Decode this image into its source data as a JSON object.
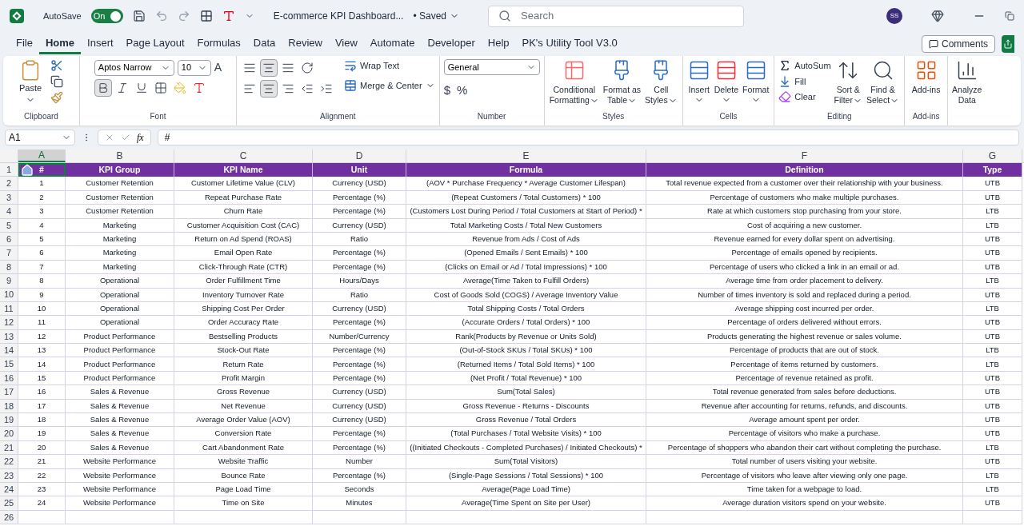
{
  "title_bar": {
    "autosave_label": "AutoSave",
    "autosave_on": true,
    "autosave_state": "On",
    "file_title": "E-commerce KPI Dashboard...",
    "save_status": "• Saved",
    "search_placeholder": "Search",
    "user_initials": "SS"
  },
  "menu_tabs": [
    {
      "label": "File",
      "selected": false
    },
    {
      "label": "Home",
      "selected": true
    },
    {
      "label": "Insert",
      "selected": false
    },
    {
      "label": "Page Layout",
      "selected": false
    },
    {
      "label": "Formulas",
      "selected": false
    },
    {
      "label": "Data",
      "selected": false
    },
    {
      "label": "Review",
      "selected": false
    },
    {
      "label": "View",
      "selected": false
    },
    {
      "label": "Automate",
      "selected": false
    },
    {
      "label": "Developer",
      "selected": false
    },
    {
      "label": "Help",
      "selected": false
    },
    {
      "label": "PK's Utility Tool V3.0",
      "selected": false
    }
  ],
  "comments_button": "Comments",
  "ribbon": {
    "clipboard": {
      "label": "Clipboard",
      "paste": "Paste"
    },
    "font": {
      "label": "Font",
      "font_name": "Aptos Narrow",
      "font_size": "10",
      "grow_font": "A",
      "bold": true,
      "italic": false,
      "underline": false
    },
    "alignment": {
      "label": "Alignment",
      "vertical_middle": true,
      "horizontal_center": true,
      "wrap_text": "Wrap Text",
      "merge": "Merge & Center"
    },
    "number": {
      "label": "Number",
      "format": "General",
      "currency": "$",
      "percent": "%"
    },
    "styles": {
      "label": "Styles",
      "buttons": [
        {
          "lines": [
            "Conditional",
            "Formatting"
          ],
          "dropdown": true
        },
        {
          "lines": [
            "Format as",
            "Table"
          ],
          "dropdown": true
        },
        {
          "lines": [
            "Cell",
            "Styles"
          ],
          "dropdown": true
        }
      ]
    },
    "cells": {
      "label": "Cells",
      "buttons": [
        {
          "lines": [
            "Insert"
          ],
          "dropdown": true
        },
        {
          "lines": [
            "Delete"
          ],
          "dropdown": true
        },
        {
          "lines": [
            "Format"
          ],
          "dropdown": true
        }
      ]
    },
    "editing": {
      "label": "Editing",
      "autosum": "AutoSum",
      "fill": "Fill",
      "clear": "Clear",
      "buttons": [
        {
          "lines": [
            "Sort &",
            "Filter"
          ],
          "dropdown": true
        },
        {
          "lines": [
            "Find &",
            "Select"
          ],
          "dropdown": true
        }
      ]
    },
    "addins": {
      "label": "Add-ins",
      "buttons": [
        {
          "lines": [
            "Add-ins"
          ],
          "dropdown": false
        }
      ]
    },
    "analyze": {
      "lines": [
        "Analyze",
        "Data"
      ]
    }
  },
  "formula_bar": {
    "name_box": "A1",
    "function_label": "fx",
    "formula": "#"
  },
  "sheet": {
    "columns": [
      {
        "label": "A",
        "selected": true
      },
      {
        "label": "B",
        "selected": false
      },
      {
        "label": "C",
        "selected": false
      },
      {
        "label": "D",
        "selected": false
      },
      {
        "label": "E",
        "selected": false
      },
      {
        "label": "F",
        "selected": false
      },
      {
        "label": "G",
        "selected": false
      }
    ],
    "row_numbers": [
      "1",
      "2",
      "3",
      "4",
      "5",
      "6",
      "7",
      "8",
      "9",
      "10",
      "11",
      "12",
      "13",
      "14",
      "15",
      "16",
      "17",
      "18",
      "19",
      "20",
      "21",
      "22",
      "23",
      "24",
      "25",
      "26"
    ],
    "header": [
      "#",
      "KPI Group",
      "KPI Name",
      "Unit",
      "Formula",
      "Definition",
      "Type"
    ],
    "rows": [
      [
        "1",
        "Customer Retention",
        "Customer Lifetime Value (CLV)",
        "Currency (USD)",
        "(AOV * Purchase Frequency * Average Customer Lifespan)",
        "Total revenue expected from a customer over their relationship with your business.",
        "UTB"
      ],
      [
        "2",
        "Customer Retention",
        "Repeat Purchase Rate",
        "Percentage (%)",
        "(Repeat Customers / Total Customers) * 100",
        "Percentage of customers who make multiple purchases.",
        "UTB"
      ],
      [
        "3",
        "Customer Retention",
        "Churn Rate",
        "Percentage (%)",
        "(Customers Lost During Period / Total Customers at Start of Period) *",
        "Rate at which customers stop purchasing from your store.",
        "LTB"
      ],
      [
        "4",
        "Marketing",
        "Customer Acquisition Cost (CAC)",
        "Currency (USD)",
        "Total Marketing Costs / Total New Customers",
        "Cost of acquiring a new customer.",
        "LTB"
      ],
      [
        "5",
        "Marketing",
        "Return on Ad Spend (ROAS)",
        "Ratio",
        "Revenue from Ads / Cost of Ads",
        "Revenue earned for every dollar spent on advertising.",
        "UTB"
      ],
      [
        "6",
        "Marketing",
        "Email Open Rate",
        "Percentage (%)",
        "(Opened Emails / Sent Emails) * 100",
        "Percentage of emails opened by recipients.",
        "UTB"
      ],
      [
        "7",
        "Marketing",
        "Click-Through Rate (CTR)",
        "Percentage (%)",
        "(Clicks on Email or Ad / Total Impressions) * 100",
        "Percentage of users who clicked a link in an email or ad.",
        "UTB"
      ],
      [
        "8",
        "Operational",
        "Order Fulfillment Time",
        "Hours/Days",
        "Average(Time Taken to Fulfill Orders)",
        "Average time from order placement to delivery.",
        "LTB"
      ],
      [
        "9",
        "Operational",
        "Inventory Turnover Rate",
        "Ratio",
        "Cost of Goods Sold (COGS) / Average Inventory Value",
        "Number of times inventory is sold and replaced during a period.",
        "UTB"
      ],
      [
        "10",
        "Operational",
        "Shipping Cost Per Order",
        "Currency (USD)",
        "Total Shipping Costs / Total Orders",
        "Average shipping cost incurred per order.",
        "LTB"
      ],
      [
        "11",
        "Operational",
        "Order Accuracy Rate",
        "Percentage (%)",
        "(Accurate Orders / Total Orders) * 100",
        "Percentage of orders delivered without errors.",
        "UTB"
      ],
      [
        "12",
        "Product Performance",
        "Bestselling Products",
        "Number/Currency",
        "Rank(Products by Revenue or Units Sold)",
        "Products generating the highest revenue or sales volume.",
        "UTB"
      ],
      [
        "13",
        "Product Performance",
        "Stock-Out Rate",
        "Percentage (%)",
        "(Out-of-Stock SKUs / Total SKUs) * 100",
        "Percentage of products that are out of stock.",
        "LTB"
      ],
      [
        "14",
        "Product Performance",
        "Return Rate",
        "Percentage (%)",
        "(Returned Items / Total Sold Items) * 100",
        "Percentage of items returned by customers.",
        "LTB"
      ],
      [
        "15",
        "Product Performance",
        "Profit Margin",
        "Percentage (%)",
        "(Net Profit / Total Revenue) * 100",
        "Percentage of revenue retained as profit.",
        "UTB"
      ],
      [
        "16",
        "Sales & Revenue",
        "Gross Revenue",
        "Currency (USD)",
        "Sum(Total Sales)",
        "Total revenue generated from sales before deductions.",
        "UTB"
      ],
      [
        "17",
        "Sales & Revenue",
        "Net Revenue",
        "Currency (USD)",
        "Gross Revenue - Returns - Discounts",
        "Revenue after accounting for returns, refunds, and discounts.",
        "UTB"
      ],
      [
        "18",
        "Sales & Revenue",
        "Average Order Value (AOV)",
        "Currency (USD)",
        "Gross Revenue / Total Orders",
        "Average amount spent per order.",
        "UTB"
      ],
      [
        "19",
        "Sales & Revenue",
        "Conversion Rate",
        "Percentage (%)",
        "(Total Purchases / Total Website Visits) * 100",
        "Percentage of visitors who make a purchase.",
        "UTB"
      ],
      [
        "20",
        "Sales & Revenue",
        "Cart Abandonment Rate",
        "Percentage (%)",
        "((Initiated Checkouts - Completed Purchases) / Initiated Checkouts) *",
        "Percentage of shoppers who abandon their cart without completing the purchase.",
        "LTB"
      ],
      [
        "21",
        "Website Performance",
        "Website Traffic",
        "Number",
        "Sum(Total Visitors)",
        "Total number of users visiting your website.",
        "UTB"
      ],
      [
        "22",
        "Website Performance",
        "Bounce Rate",
        "Percentage (%)",
        "(Single-Page Sessions / Total Sessions) * 100",
        "Percentage of visitors who leave after viewing only one page.",
        "LTB"
      ],
      [
        "23",
        "Website Performance",
        "Page Load Time",
        "Seconds",
        "Average(Page Load Time)",
        "Time taken for a webpage to load.",
        "LTB"
      ],
      [
        "24",
        "Website Performance",
        "Time on Site",
        "Minutes",
        "Average(Time Spent on Site per User)",
        "Average duration visitors spend on your website.",
        "UTB"
      ]
    ]
  }
}
